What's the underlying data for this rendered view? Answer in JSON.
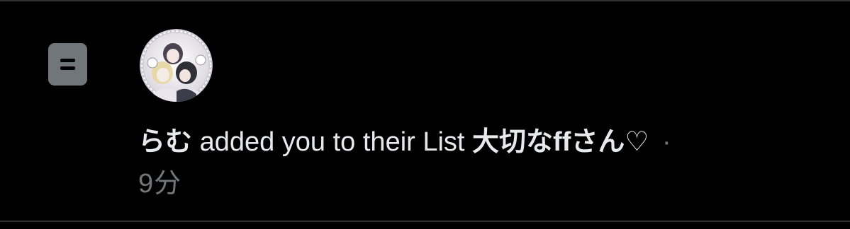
{
  "notification": {
    "icon": "list-icon",
    "avatar_icon": "user-avatar",
    "user_name": "らむ",
    "action_text": " added you to their List ",
    "list_name": "大切なffさん♡",
    "separator": " ·",
    "timestamp": "9分"
  },
  "colors": {
    "background": "#000000",
    "primary_text": "#e7e9ea",
    "secondary_text": "#71767b",
    "divider": "#2f3336"
  }
}
